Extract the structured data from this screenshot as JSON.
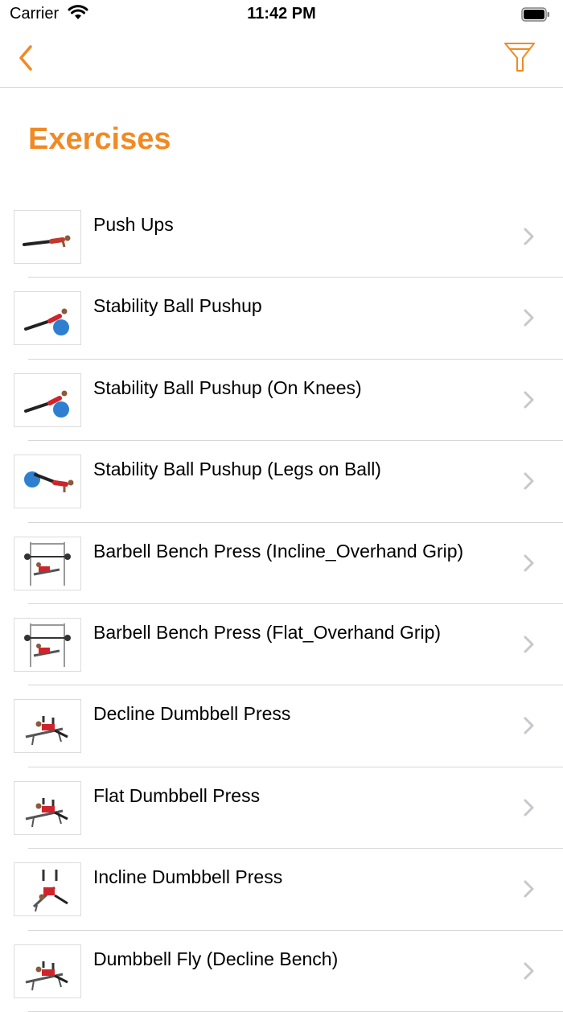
{
  "status_bar": {
    "carrier": "Carrier",
    "time": "11:42 PM"
  },
  "nav": {
    "back_icon": "chevron-left-icon",
    "filter_icon": "filter-icon"
  },
  "page": {
    "title": "Exercises"
  },
  "colors": {
    "accent": "#f08a24",
    "separator": "#d6d6d6",
    "chevron": "#c7c7cc"
  },
  "exercises": [
    {
      "name": "Push Ups",
      "thumb": "pushup"
    },
    {
      "name": "Stability Ball Pushup",
      "thumb": "ball"
    },
    {
      "name": "Stability Ball Pushup (On Knees)",
      "thumb": "ball"
    },
    {
      "name": "Stability Ball Pushup (Legs on Ball)",
      "thumb": "ball-legs"
    },
    {
      "name": "Barbell Bench Press (Incline_Overhand Grip)",
      "thumb": "rack"
    },
    {
      "name": "Barbell Bench Press (Flat_Overhand Grip)",
      "thumb": "rack"
    },
    {
      "name": "Decline Dumbbell Press",
      "thumb": "bench"
    },
    {
      "name": "Flat Dumbbell Press",
      "thumb": "bench"
    },
    {
      "name": "Incline Dumbbell Press",
      "thumb": "bench-incline"
    },
    {
      "name": "Dumbbell Fly (Decline Bench)",
      "thumb": "bench"
    }
  ]
}
